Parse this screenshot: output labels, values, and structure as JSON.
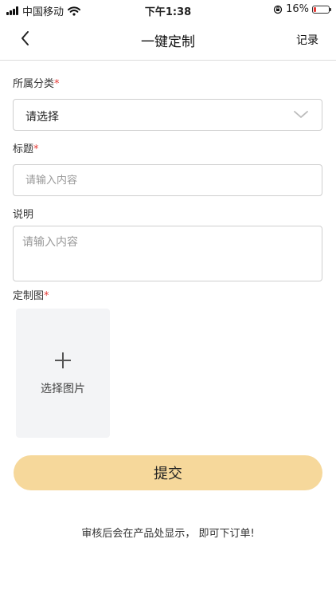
{
  "status_bar": {
    "carrier": "中国移动",
    "time": "下午1:38",
    "battery": "16%",
    "battery_level": 0.16,
    "battery_color": "#e53935"
  },
  "nav": {
    "back_icon": "chevron-left-icon",
    "title": "一键定制",
    "record": "记录"
  },
  "form": {
    "category": {
      "label": "所属分类",
      "required_mark": "*",
      "value": "请选择"
    },
    "title": {
      "label": "标题",
      "required_mark": "*",
      "placeholder": "请输入内容"
    },
    "description": {
      "label": "说明",
      "placeholder": "请输入内容"
    },
    "image": {
      "label": "定制图",
      "required_mark": "*",
      "upload_label": "选择图片",
      "upload_icon": "plus-icon"
    },
    "submit": "提交"
  },
  "footer_note": "审核后会在产品处显示， 即可下订单!",
  "colors": {
    "accent_button": "#f6d89b",
    "required": "#e53935",
    "upload_bg": "#f3f4f6"
  }
}
